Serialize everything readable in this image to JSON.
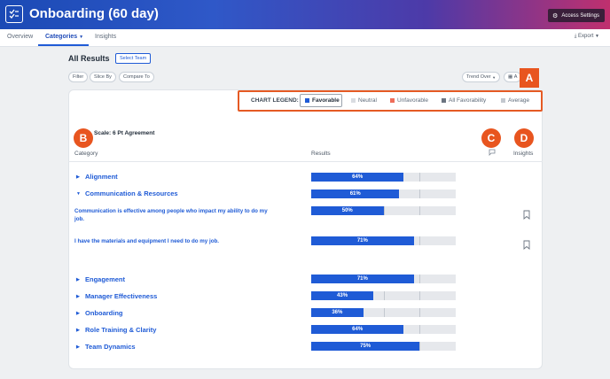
{
  "header": {
    "title": "Onboarding (60 day)",
    "access_settings": "Access Settings"
  },
  "nav": {
    "tabs": [
      "Overview",
      "Categories",
      "Insights"
    ],
    "export": "Export"
  },
  "toolbar": {
    "all_results": "All Results",
    "select_team": "Select Team",
    "filter": "Filter",
    "slice_by": "Slice By",
    "compare_to": "Compare To",
    "trend_over": "Trend Over",
    "partial_button": "A"
  },
  "legend": {
    "label": "CHART LEGEND:",
    "items": [
      {
        "label": "Favorable",
        "color": "#1f5bd6"
      },
      {
        "label": "Neutral",
        "color": "#d9dce1"
      },
      {
        "label": "Unfavorable",
        "color": "#ef6d5a"
      },
      {
        "label": "All Favorability",
        "color": "#6b7480"
      },
      {
        "label": "Average",
        "color": "#c3c8cf"
      }
    ]
  },
  "badges": {
    "a": "A",
    "b": "B",
    "c": "C",
    "d": "D"
  },
  "table": {
    "scale": "Scale: 6 Pt Agreement",
    "col_category": "Category",
    "col_results": "Results",
    "col_insights": "Insights"
  },
  "rows": [
    {
      "label": "Alignment",
      "value": 64,
      "value_text": "64%",
      "expanded": false
    },
    {
      "label": "Communication & Resources",
      "value": 61,
      "value_text": "61%",
      "expanded": true
    },
    {
      "label": "Engagement",
      "value": 71,
      "value_text": "71%",
      "expanded": false
    },
    {
      "label": "Manager Effectiveness",
      "value": 43,
      "value_text": "43%",
      "expanded": false
    },
    {
      "label": "Onboarding",
      "value": 36,
      "value_text": "36%",
      "expanded": false
    },
    {
      "label": "Role Training & Clarity",
      "value": 64,
      "value_text": "64%",
      "expanded": false
    },
    {
      "label": "Team Dynamics",
      "value": 75,
      "value_text": "75%",
      "expanded": false
    }
  ],
  "questions": [
    {
      "label": "Communication is effective among people who impact my ability to do my job.",
      "value": 50,
      "value_text": "50%"
    },
    {
      "label": "I have the materials and equipment I need to do my job.",
      "value": 71,
      "value_text": "71%"
    }
  ]
}
